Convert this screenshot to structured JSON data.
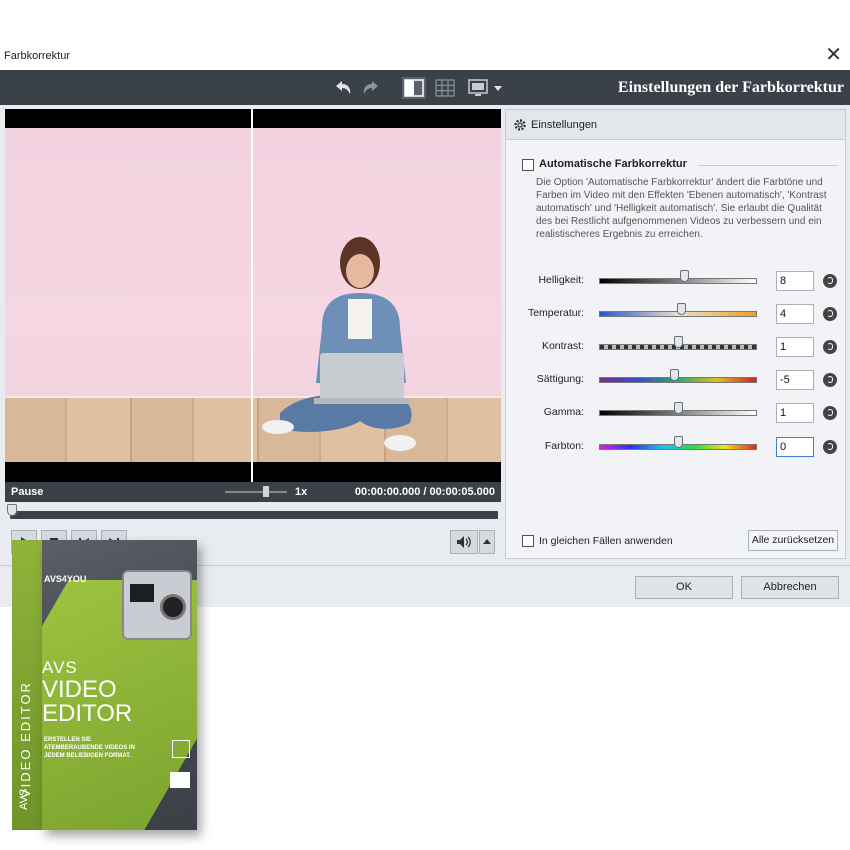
{
  "window": {
    "title": "Farbkorrektur",
    "close": "✕"
  },
  "toolbar": {
    "heading": "Einstellungen der Farbkorrektur"
  },
  "player": {
    "state": "Pause",
    "speed": "1x",
    "current_time": "00:00:00.000",
    "separator": "/",
    "total_time": "00:00:05.000",
    "progress_fraction": 0.0
  },
  "settings": {
    "header": "Einstellungen",
    "auto": {
      "label": "Automatische Farbkorrektur",
      "checked": false,
      "description": "Die Option 'Automatische Farbkorrektur' ändert die Farbtöne und Farben im Video mit den Effekten 'Ebenen automatisch', 'Kontrast automatisch' und 'Helligkeit automatisch'. Sie erlaubt die Qualität des bei Restlicht aufgenommenen Videos zu verbessern und ein realistischeres Ergebnis zu erreichen."
    },
    "sliders": [
      {
        "label": "Helligkeit:",
        "value": "8",
        "level": 0.54
      },
      {
        "label": "Temperatur:",
        "value": "4",
        "level": 0.52
      },
      {
        "label": "Kontrast:",
        "value": "1",
        "level": 0.505
      },
      {
        "label": "Sättigung:",
        "value": "-5",
        "level": 0.475
      },
      {
        "label": "Gamma:",
        "value": "1",
        "level": 0.505
      },
      {
        "label": "Farbton:",
        "value": "0",
        "level": 0.5
      }
    ],
    "apply_same": {
      "label": "In gleichen Fällen anwenden",
      "checked": false
    },
    "reset_all": "Alle zurücksetzen"
  },
  "footer": {
    "ok": "OK",
    "cancel": "Abbrechen"
  },
  "product_box": {
    "brand": "AVS",
    "title_line1": "VIDEO",
    "title_line2": "EDITOR",
    "spine_title": "VIDEO EDITOR",
    "spine_brand": "AVS",
    "logo": "AVS4YOU",
    "tagline": "ERSTELLEN SIE ATEMBERAUBENDE VIDEOS IN JEDEM BELIEBIGEN FORMAT."
  },
  "colors": {
    "toolbar_bg": "#3b4149",
    "dialog_bg": "#e8ebef",
    "accent_green": "#8fb33a"
  }
}
